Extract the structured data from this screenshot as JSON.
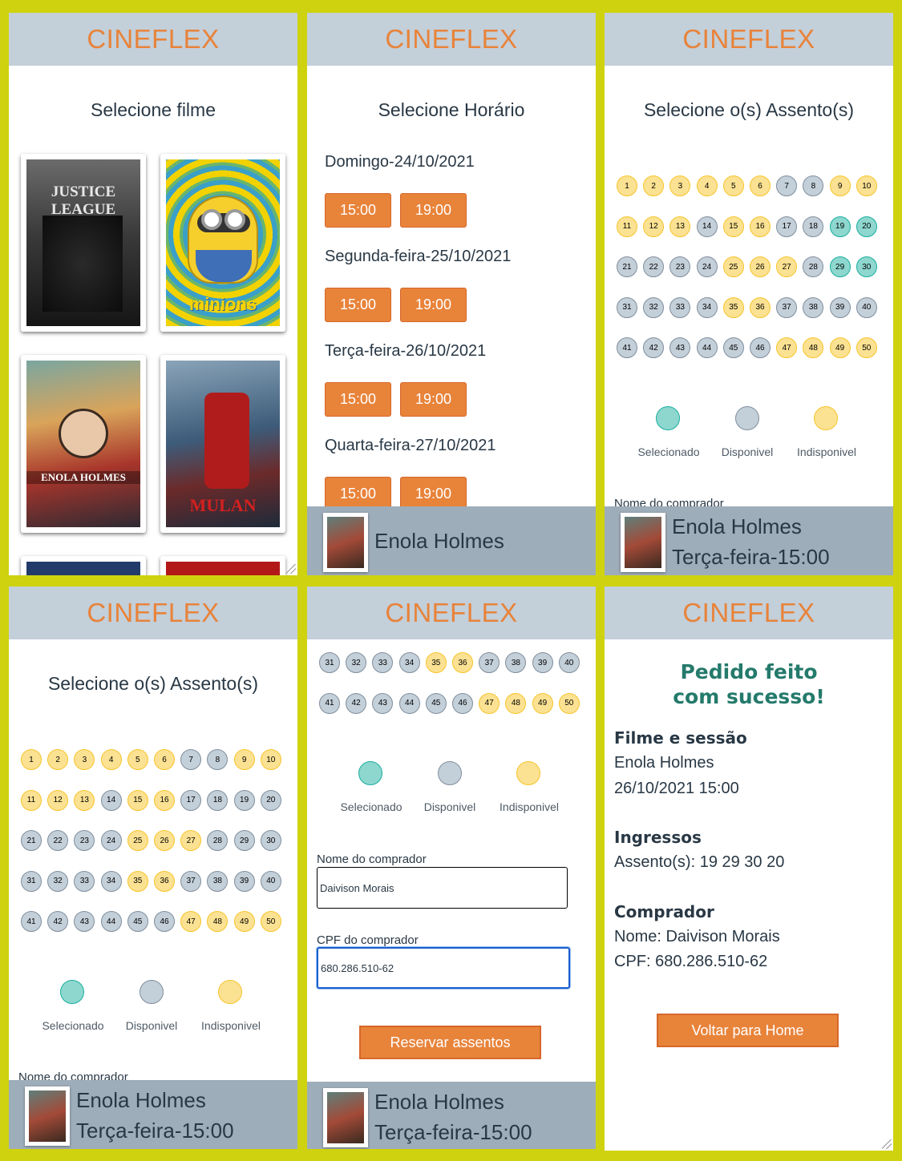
{
  "brand": "CINEFLEX",
  "colors": {
    "accent": "#e8833a",
    "header_bg": "#c3cfd9",
    "selected": "#8dd7cf",
    "available": "#c3cfd9",
    "unavailable": "#fbe192",
    "frame": "#cfd20e"
  },
  "movies_screen": {
    "title": "Selecione filme",
    "movies": [
      {
        "name": "Justice League",
        "poster_text": "JUSTICE LEAGUE"
      },
      {
        "name": "Minions",
        "poster_text": "minions"
      },
      {
        "name": "Enola Holmes",
        "poster_text": "ENOLA HOLMES"
      },
      {
        "name": "Mulan",
        "poster_text": "MULAN"
      }
    ]
  },
  "sessions_screen": {
    "title": "Selecione Horário",
    "days": [
      {
        "label": "Domingo-24/10/2021",
        "times": [
          "15:00",
          "19:00"
        ]
      },
      {
        "label": "Segunda-feira-25/10/2021",
        "times": [
          "15:00",
          "19:00"
        ]
      },
      {
        "label": "Terça-feira-26/10/2021",
        "times": [
          "15:00",
          "19:00"
        ]
      },
      {
        "label": "Quarta-feira-27/10/2021",
        "times": [
          "15:00",
          "19:00"
        ]
      }
    ],
    "footer_title": "Enola Holmes"
  },
  "seats_screen": {
    "title": "Selecione o(s) Assento(s)",
    "legend": {
      "selected": "Selecionado",
      "available": "Disponivel",
      "unavailable": "Indisponivel"
    },
    "buyer_name_label": "Nome do comprador",
    "buyer_cpf_label": "CPF do comprador",
    "buyer_name_value": "Daivison Morais",
    "buyer_cpf_value": "680.286.510-62",
    "reserve_button": "Reservar assentos",
    "footer_title": "Enola Holmes",
    "footer_session": "Terça-feira-15:00",
    "unavailable_seats": [
      1,
      2,
      3,
      4,
      5,
      6,
      9,
      10,
      11,
      12,
      13,
      15,
      16,
      25,
      26,
      27,
      35,
      36,
      47,
      48,
      49,
      50
    ],
    "selected_seats_panel3": [
      19,
      20,
      29,
      30
    ]
  },
  "success_screen": {
    "title_line1": "Pedido feito",
    "title_line2": "com sucesso!",
    "movie_heading": "Filme e sessão",
    "movie_name": "Enola Holmes",
    "movie_datetime": "26/10/2021 15:00",
    "tickets_heading": "Ingressos",
    "tickets_value": "Assento(s): 19 29 30 20",
    "buyer_heading": "Comprador",
    "buyer_name": "Nome: Daivison Morais",
    "buyer_cpf": "CPF: 680.286.510-62",
    "home_button": "Voltar para Home"
  }
}
